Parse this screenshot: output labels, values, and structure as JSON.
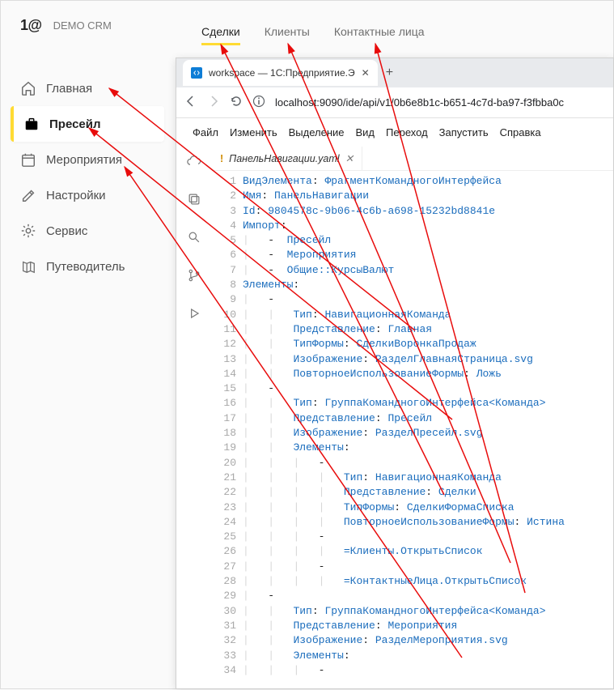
{
  "crm": {
    "logo": "1@",
    "title": "DEMO CRM",
    "tabs": [
      {
        "label": "Сделки",
        "active": true
      },
      {
        "label": "Клиенты",
        "active": false
      },
      {
        "label": "Контактные лица",
        "active": false
      }
    ],
    "sidebar": [
      {
        "label": "Главная",
        "icon": "home"
      },
      {
        "label": "Пресейл",
        "icon": "briefcase",
        "active": true
      },
      {
        "label": "Мероприятия",
        "icon": "calendar"
      },
      {
        "label": "Настройки",
        "icon": "edit"
      },
      {
        "label": "Сервис",
        "icon": "gear"
      },
      {
        "label": "Путеводитель",
        "icon": "map"
      }
    ]
  },
  "browser": {
    "tab_title": "workspace — 1С:Предприятие.Э",
    "url_text": "localhost:9090/ide/api/v1/0b6e8b1c-b651-4c7d-ba97-f3fbba0c"
  },
  "ide": {
    "menu": [
      "Файл",
      "Изменить",
      "Выделение",
      "Вид",
      "Переход",
      "Запустить",
      "Справка"
    ],
    "file": "ПанельНавигации.yaml",
    "code_lines": [
      [
        [
          "k",
          "ВидЭлемента"
        ],
        [
          "p",
          ": "
        ],
        [
          "v",
          "ФрагментКомандногоИнтерфейса"
        ]
      ],
      [
        [
          "k",
          "Имя"
        ],
        [
          "p",
          ": "
        ],
        [
          "v",
          "ПанельНавигации"
        ]
      ],
      [
        [
          "k",
          "Id"
        ],
        [
          "p",
          ": "
        ],
        [
          "id",
          "9804578c-9b06-4c6b-a698-15232bd8841e"
        ]
      ],
      [
        [
          "k",
          "Импорт"
        ],
        [
          "p",
          ":"
        ]
      ],
      [
        [
          "p",
          "    -  "
        ],
        [
          "v",
          "Пресейл"
        ]
      ],
      [
        [
          "p",
          "    -  "
        ],
        [
          "v",
          "Мероприятия"
        ]
      ],
      [
        [
          "p",
          "    -  "
        ],
        [
          "v",
          "Общие::КурсыВалют"
        ]
      ],
      [
        [
          "k",
          "Элементы"
        ],
        [
          "p",
          ":"
        ]
      ],
      [
        [
          "p",
          "    -"
        ]
      ],
      [
        [
          "p",
          "        "
        ],
        [
          "k",
          "Тип"
        ],
        [
          "p",
          ": "
        ],
        [
          "v",
          "НавигационнаяКоманда"
        ]
      ],
      [
        [
          "p",
          "        "
        ],
        [
          "k",
          "Представление"
        ],
        [
          "p",
          ": "
        ],
        [
          "v",
          "Главная"
        ]
      ],
      [
        [
          "p",
          "        "
        ],
        [
          "k",
          "ТипФормы"
        ],
        [
          "p",
          ": "
        ],
        [
          "v",
          "СделкиВоронкаПродаж"
        ]
      ],
      [
        [
          "p",
          "        "
        ],
        [
          "k",
          "Изображение"
        ],
        [
          "p",
          ": "
        ],
        [
          "v",
          "РазделГлавнаяСтраница.svg"
        ]
      ],
      [
        [
          "p",
          "        "
        ],
        [
          "k",
          "ПовторноеИспользованиеФормы"
        ],
        [
          "p",
          ": "
        ],
        [
          "v",
          "Ложь"
        ]
      ],
      [
        [
          "p",
          "    -"
        ]
      ],
      [
        [
          "p",
          "        "
        ],
        [
          "k",
          "Тип"
        ],
        [
          "p",
          ": "
        ],
        [
          "v",
          "ГруппаКомандногоИнтерфейса<Команда>"
        ]
      ],
      [
        [
          "p",
          "        "
        ],
        [
          "k",
          "Представление"
        ],
        [
          "p",
          ": "
        ],
        [
          "v",
          "Пресейл"
        ]
      ],
      [
        [
          "p",
          "        "
        ],
        [
          "k",
          "Изображение"
        ],
        [
          "p",
          ": "
        ],
        [
          "v",
          "РазделПресейл.svg"
        ]
      ],
      [
        [
          "p",
          "        "
        ],
        [
          "k",
          "Элементы"
        ],
        [
          "p",
          ":"
        ]
      ],
      [
        [
          "p",
          "            -"
        ]
      ],
      [
        [
          "p",
          "                "
        ],
        [
          "k",
          "Тип"
        ],
        [
          "p",
          ": "
        ],
        [
          "v",
          "НавигационнаяКоманда"
        ]
      ],
      [
        [
          "p",
          "                "
        ],
        [
          "k",
          "Представление"
        ],
        [
          "p",
          ": "
        ],
        [
          "v",
          "Сделки"
        ]
      ],
      [
        [
          "p",
          "                "
        ],
        [
          "k",
          "ТипФормы"
        ],
        [
          "p",
          ": "
        ],
        [
          "v",
          "СделкиФормаСписка"
        ]
      ],
      [
        [
          "p",
          "                "
        ],
        [
          "k",
          "ПовторноеИспользованиеФормы"
        ],
        [
          "p",
          ": "
        ],
        [
          "v",
          "Истина"
        ]
      ],
      [
        [
          "p",
          "            -"
        ]
      ],
      [
        [
          "p",
          "                "
        ],
        [
          "v",
          "=Клиенты.ОткрытьСписок"
        ]
      ],
      [
        [
          "p",
          "            -"
        ]
      ],
      [
        [
          "p",
          "                "
        ],
        [
          "v",
          "=КонтактныеЛица.ОткрытьСписок"
        ]
      ],
      [
        [
          "p",
          "    -"
        ]
      ],
      [
        [
          "p",
          "        "
        ],
        [
          "k",
          "Тип"
        ],
        [
          "p",
          ": "
        ],
        [
          "v",
          "ГруппаКомандногоИнтерфейса<Команда>"
        ]
      ],
      [
        [
          "p",
          "        "
        ],
        [
          "k",
          "Представление"
        ],
        [
          "p",
          ": "
        ],
        [
          "v",
          "Мероприятия"
        ]
      ],
      [
        [
          "p",
          "        "
        ],
        [
          "k",
          "Изображение"
        ],
        [
          "p",
          ": "
        ],
        [
          "v",
          "РазделМероприятия.svg"
        ]
      ],
      [
        [
          "p",
          "        "
        ],
        [
          "k",
          "Элементы"
        ],
        [
          "p",
          ":"
        ]
      ],
      [
        [
          "p",
          "            -"
        ]
      ]
    ]
  }
}
